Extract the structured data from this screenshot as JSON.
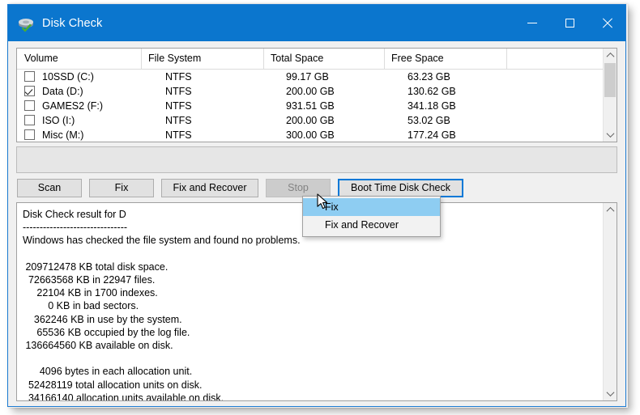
{
  "window": {
    "title": "Disk Check",
    "icon": "disk-check-icon",
    "accent_color": "#0b76ce",
    "controls": {
      "minimize": "minimize-icon",
      "maximize": "maximize-icon",
      "close": "close-icon"
    }
  },
  "volume_list": {
    "columns": [
      "Volume",
      "File System",
      "Total Space",
      "Free Space"
    ],
    "rows": [
      {
        "checked": false,
        "volume": "10SSD (C:)",
        "file_system": "NTFS",
        "total_space": "99.17 GB",
        "free_space": "63.23 GB"
      },
      {
        "checked": true,
        "volume": "Data (D:)",
        "file_system": "NTFS",
        "total_space": "200.00 GB",
        "free_space": "130.62 GB"
      },
      {
        "checked": false,
        "volume": "GAMES2 (F:)",
        "file_system": "NTFS",
        "total_space": "931.51 GB",
        "free_space": "341.18 GB"
      },
      {
        "checked": false,
        "volume": "ISO (I:)",
        "file_system": "NTFS",
        "total_space": "200.00 GB",
        "free_space": "53.02 GB"
      },
      {
        "checked": false,
        "volume": "Misc (M:)",
        "file_system": "NTFS",
        "total_space": "300.00 GB",
        "free_space": "177.24 GB"
      }
    ],
    "scrollbar": {
      "up_arrow": "chevron-up-icon",
      "down_arrow": "chevron-down-icon"
    }
  },
  "buttons": [
    {
      "label": "Scan",
      "state": "normal"
    },
    {
      "label": "Fix",
      "state": "normal"
    },
    {
      "label": "Fix and Recover",
      "state": "normal"
    },
    {
      "label": "Stop",
      "state": "disabled"
    },
    {
      "label": "Boot Time Disk Check",
      "state": "focused"
    }
  ],
  "dropdown": {
    "open": true,
    "items": [
      {
        "label": "Fix",
        "highlighted": true
      },
      {
        "label": "Fix and Recover",
        "highlighted": false
      }
    ],
    "highlight_color": "#8ecdf2"
  },
  "result_panel": {
    "text": "Disk Check result for D\n-------------------------------\nWindows has checked the file system and found no problems.\n\n 209712478 KB total disk space.\n  72663568 KB in 22947 files.\n     22104 KB in 1700 indexes.\n         0 KB in bad sectors.\n    362246 KB in use by the system.\n     65536 KB occupied by the log file.\n 136664560 KB available on disk.\n\n      4096 bytes in each allocation unit.\n  52428119 total allocation units on disk.\n  34166140 allocation units available on disk.",
    "scrollbar": {
      "up_arrow": "chevron-up-icon",
      "down_arrow": "chevron-down-icon"
    }
  }
}
